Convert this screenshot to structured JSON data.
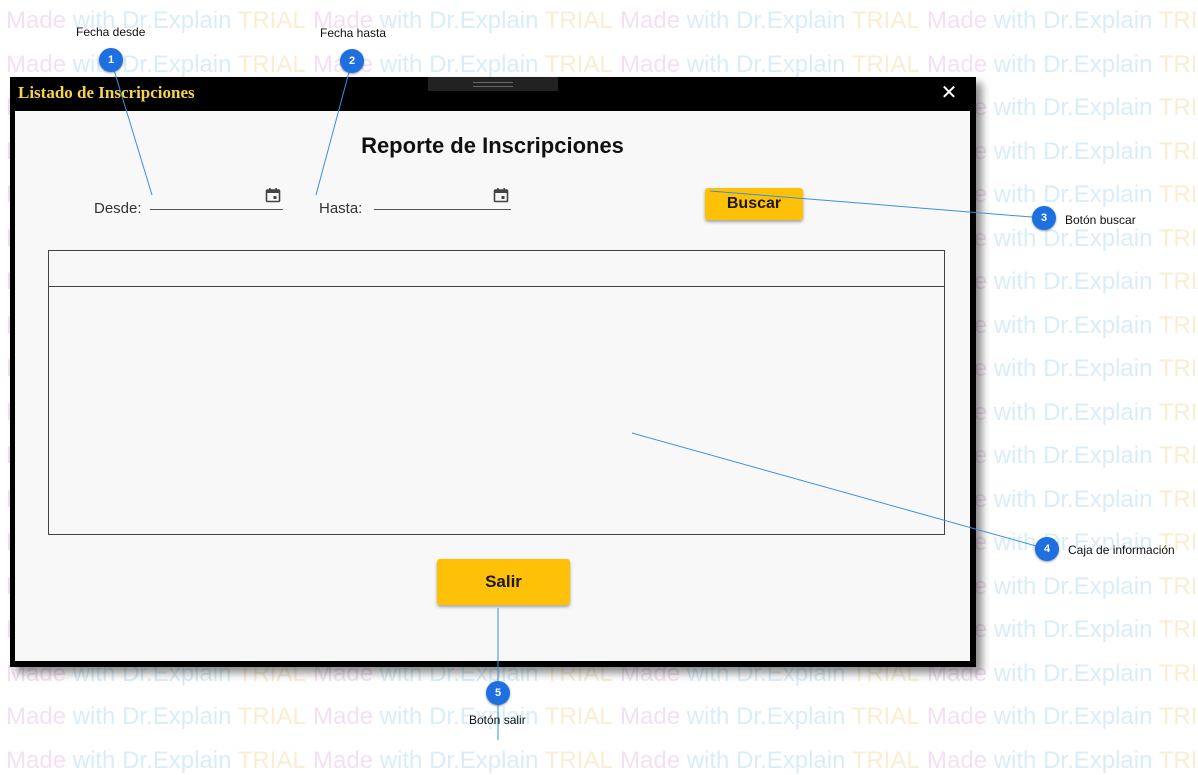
{
  "watermark": {
    "part1": "Made",
    "part2": " with Dr.Explain ",
    "part3": "TRIAL"
  },
  "window": {
    "title": "Listado de Inscripciones",
    "close_icon": "✕"
  },
  "report": {
    "title": "Reporte de Inscripciones",
    "desde_label": "Desde:",
    "hasta_label": "Hasta:",
    "desde_value": "",
    "hasta_value": "",
    "search_button": "Buscar",
    "exit_button": "Salir"
  },
  "callouts": [
    {
      "number": "1",
      "label": "Fecha desde"
    },
    {
      "number": "2",
      "label": "Fecha hasta"
    },
    {
      "number": "3",
      "label": "Botón buscar"
    },
    {
      "number": "4",
      "label": "Caja de información"
    },
    {
      "number": "5",
      "label": "Botón salir"
    }
  ],
  "colors": {
    "accent": "#ffc107",
    "title": "#f5d34a",
    "callout": "#1e6fe0"
  }
}
